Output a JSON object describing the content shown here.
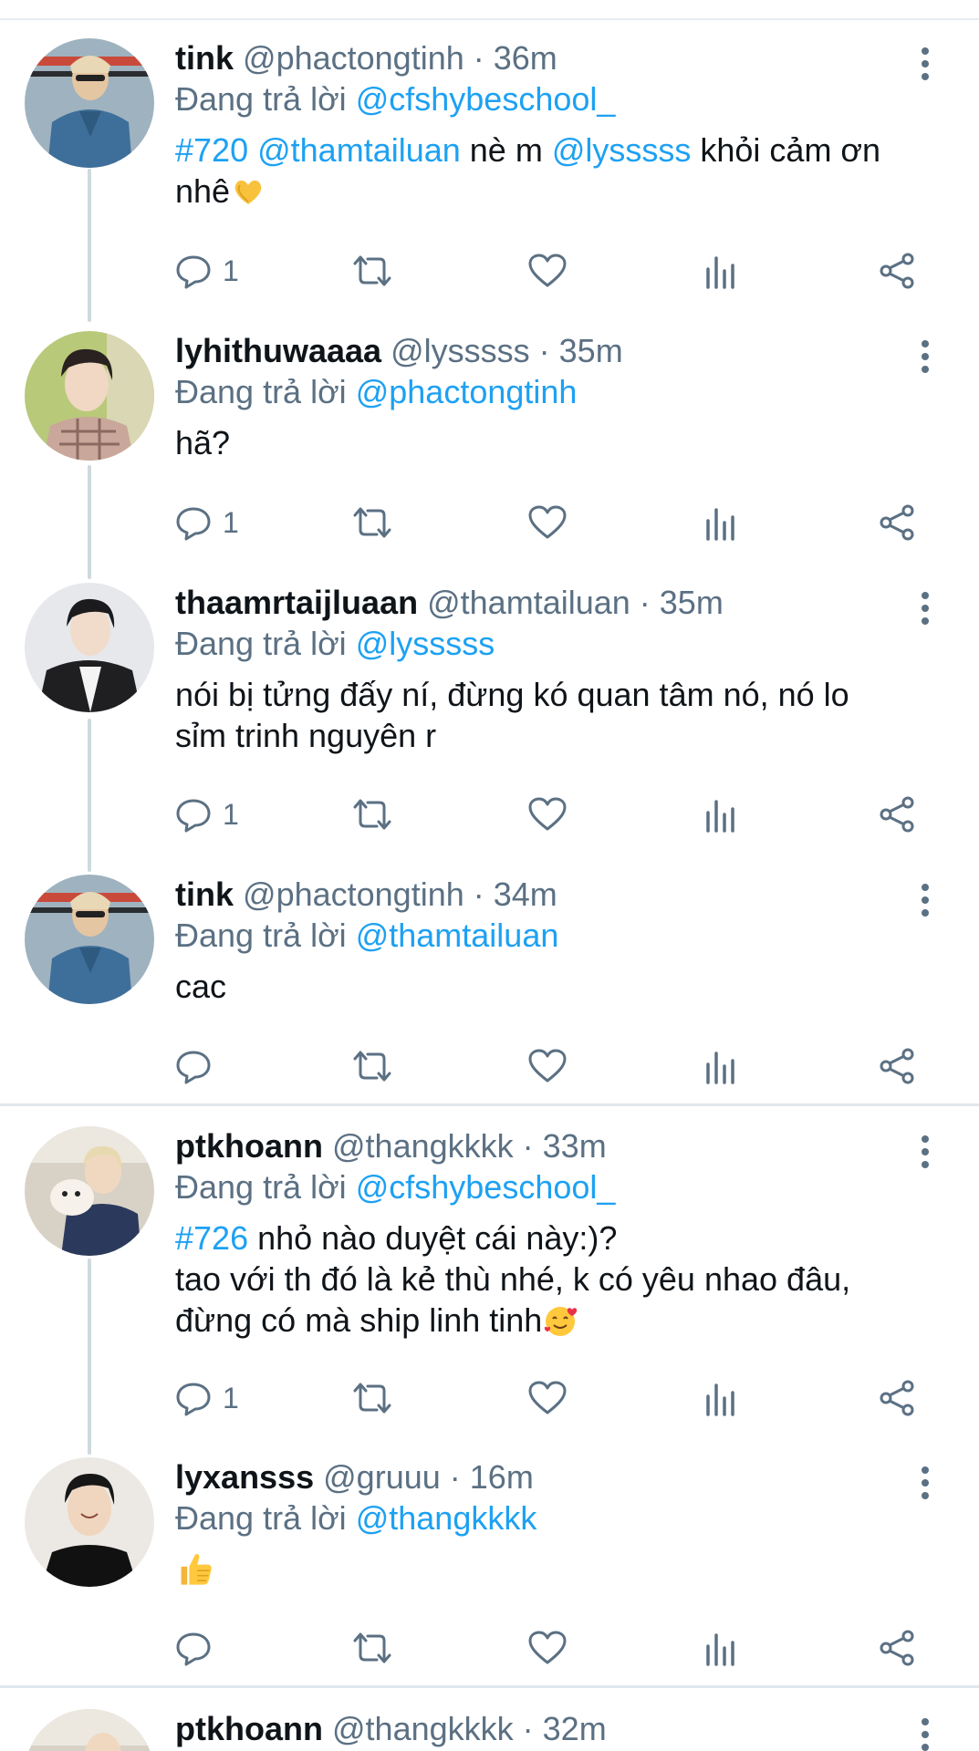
{
  "reply_prefix": "Đang trả lời",
  "colors": {
    "accent": "#1da1f2",
    "secondary": "#5b7083",
    "text": "#0f1419"
  },
  "tweets": [
    {
      "name": "tink",
      "handle": "@phactongtinh",
      "time": "· 36m",
      "reply_to": "@cfshybeschool_",
      "text_parts": [
        "#720",
        " ",
        "@thamtailuan",
        " nè m ",
        "@lysssss",
        " khỏi cảm ơn\nnhê"
      ],
      "emoji": "heart-hands-emoji",
      "reply_count": "1",
      "avatar": "denim-jacket-avatar"
    },
    {
      "name": "lyhithuwaaaa",
      "handle": "@lysssss",
      "time": "· 35m",
      "reply_to": "@phactongtinh",
      "text": "hã?",
      "reply_count": "1",
      "avatar": "plaid-shirt-avatar"
    },
    {
      "name": "thaamrtaijluaan",
      "handle": "@thamtailuan",
      "time": "· 35m",
      "reply_to": "@lysssss",
      "text": "nói bị tửng đấy ní, đừng kó quan tâm nó, nó lo\nsỉm trinh nguyên r",
      "reply_count": "1",
      "avatar": "dark-jacket-avatar"
    },
    {
      "name": "tink",
      "handle": "@phactongtinh",
      "time": "· 34m",
      "reply_to": "@thamtailuan",
      "text": "cac",
      "reply_count": "",
      "avatar": "denim-jacket-avatar"
    },
    {
      "name": "ptkhoann",
      "handle": "@thangkkkk",
      "time": "· 33m",
      "reply_to": "@cfshybeschool_",
      "hashtag": "#726",
      "text_after_hashtag": " nhỏ nào duyệt cái này:)?\ntao với th đó là kẻ thù nhé, k có yêu nhao đâu,\nđừng có mà ship linh tinh",
      "emoji": "smiling-face-with-hearts-emoji",
      "reply_count": "1",
      "avatar": "dog-hug-avatar"
    },
    {
      "name": "lyxansss",
      "handle": "@gruuu",
      "time": "· 16m",
      "reply_to": "@thangkkkk",
      "emoji": "thumbs-up-emoji",
      "reply_count": "",
      "avatar": "black-tank-avatar"
    },
    {
      "name": "ptkhoann",
      "handle": "@thangkkkk",
      "time": "· 32m",
      "avatar": "dog-hug-avatar"
    }
  ]
}
